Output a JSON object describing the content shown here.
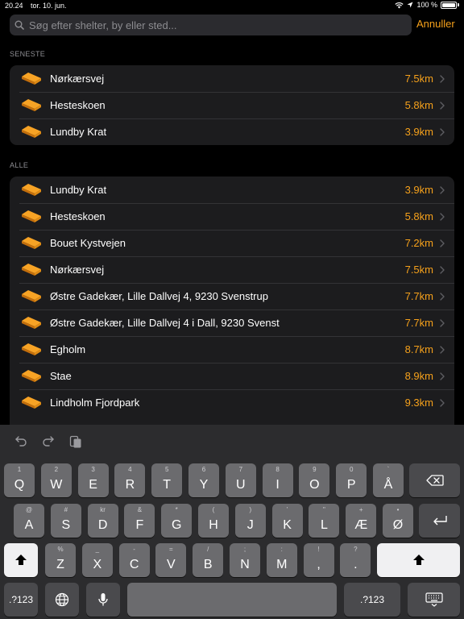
{
  "status_bar": {
    "time": "20.24",
    "date": "tor. 10. jun.",
    "battery": "100 %"
  },
  "search": {
    "placeholder": "Søg efter shelter, by eller sted...",
    "value": "",
    "cancel_label": "Annuller"
  },
  "sections": [
    {
      "title": "SENESTE",
      "items": [
        {
          "name": "Nørkærsvej",
          "distance": "7.5km"
        },
        {
          "name": "Hesteskoen",
          "distance": "5.8km"
        },
        {
          "name": "Lundby Krat",
          "distance": "3.9km"
        }
      ]
    },
    {
      "title": "ALLE",
      "items": [
        {
          "name": "Lundby Krat",
          "distance": "3.9km"
        },
        {
          "name": "Hesteskoen",
          "distance": "5.8km"
        },
        {
          "name": "Bouet Kystvejen",
          "distance": "7.2km"
        },
        {
          "name": "Nørkærsvej",
          "distance": "7.5km"
        },
        {
          "name": "Østre Gadekær, Lille Dallvej 4, 9230 Svenstrup",
          "distance": "7.7km"
        },
        {
          "name": "Østre Gadekær, Lille Dallvej 4 i Dall, 9230 Svenst",
          "distance": "7.7km"
        },
        {
          "name": "Egholm",
          "distance": "8.7km"
        },
        {
          "name": "Stae",
          "distance": "8.9km"
        },
        {
          "name": "Lindholm Fjordpark",
          "distance": "9.3km"
        }
      ]
    }
  ],
  "keyboard": {
    "row1": [
      {
        "main": "Q",
        "sub": "1"
      },
      {
        "main": "W",
        "sub": "2"
      },
      {
        "main": "E",
        "sub": "3"
      },
      {
        "main": "R",
        "sub": "4"
      },
      {
        "main": "T",
        "sub": "5"
      },
      {
        "main": "Y",
        "sub": "6"
      },
      {
        "main": "U",
        "sub": "7"
      },
      {
        "main": "I",
        "sub": "8"
      },
      {
        "main": "O",
        "sub": "9"
      },
      {
        "main": "P",
        "sub": "0"
      },
      {
        "main": "Å",
        "sub": "`"
      }
    ],
    "row2": [
      {
        "main": "A",
        "sub": "@"
      },
      {
        "main": "S",
        "sub": "#"
      },
      {
        "main": "D",
        "sub": "kr"
      },
      {
        "main": "F",
        "sub": "&"
      },
      {
        "main": "G",
        "sub": "*"
      },
      {
        "main": "H",
        "sub": "("
      },
      {
        "main": "J",
        "sub": ")"
      },
      {
        "main": "K",
        "sub": "’"
      },
      {
        "main": "L",
        "sub": "\""
      },
      {
        "main": "Æ",
        "sub": "+"
      },
      {
        "main": "Ø",
        "sub": "•"
      }
    ],
    "row3": [
      {
        "main": "Z",
        "sub": "%"
      },
      {
        "main": "X",
        "sub": "_"
      },
      {
        "main": "C",
        "sub": "-"
      },
      {
        "main": "V",
        "sub": "="
      },
      {
        "main": "B",
        "sub": "/"
      },
      {
        "main": "N",
        "sub": ";"
      },
      {
        "main": "M",
        "sub": ":"
      },
      {
        "main": ",",
        "sub": "!"
      },
      {
        "main": ".",
        "sub": "?"
      }
    ],
    "numbers_label": ".?123"
  },
  "colors": {
    "accent": "#f6a11b",
    "background": "#000000",
    "cell": "#1c1c1e"
  }
}
